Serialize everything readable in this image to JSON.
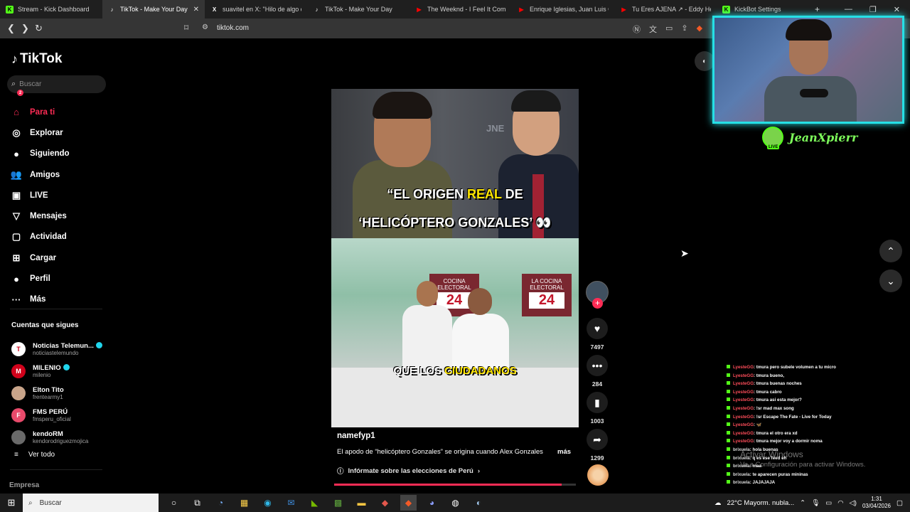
{
  "browser": {
    "tabs": [
      {
        "title": "Stream - Kick Dashboard",
        "color": "#53fc18",
        "glyph": "K",
        "active": false
      },
      {
        "title": "TikTok - Make Your Day",
        "color": "#ffffff",
        "glyph": "♪",
        "active": true
      },
      {
        "title": "suavitel en X: \"Hilo de algo que",
        "color": "#ffffff",
        "glyph": "X",
        "active": false
      },
      {
        "title": "TikTok - Make Your Day",
        "color": "#ffffff",
        "glyph": "♪",
        "active": false
      },
      {
        "title": "The Weeknd - I Feel It Coming",
        "color": "#ff0000",
        "glyph": "▶",
        "active": false
      },
      {
        "title": "Enrique Iglesias, Juan Luis Gue",
        "color": "#ff0000",
        "glyph": "▶",
        "active": false
      },
      {
        "title": "Tu Eres AJENA ↗ - Eddy Herr",
        "color": "#ff0000",
        "glyph": "▶",
        "active": false
      },
      {
        "title": "KickBot Settings",
        "color": "#53fc18",
        "glyph": "K",
        "active": false
      }
    ],
    "url": "tiktok.com"
  },
  "sidebar": {
    "logo": "TikTok",
    "search_placeholder": "Buscar",
    "menu": [
      {
        "label": "Para ti",
        "icon": "home-icon",
        "glyph": "⌂",
        "active": true
      },
      {
        "label": "Explorar",
        "icon": "compass-icon",
        "glyph": "◎",
        "active": false
      },
      {
        "label": "Siguiendo",
        "icon": "following-avatar-icon",
        "glyph": "●",
        "active": false
      },
      {
        "label": "Amigos",
        "icon": "friends-icon",
        "glyph": "👥",
        "active": false
      },
      {
        "label": "LIVE",
        "icon": "live-icon",
        "glyph": "▣",
        "active": false
      },
      {
        "label": "Mensajes",
        "icon": "messages-icon",
        "glyph": "▽",
        "active": false
      },
      {
        "label": "Actividad",
        "icon": "activity-icon",
        "glyph": "▢",
        "active": false,
        "badge": "2"
      },
      {
        "label": "Cargar",
        "icon": "upload-icon",
        "glyph": "⊞",
        "active": false
      },
      {
        "label": "Perfil",
        "icon": "profile-icon",
        "glyph": "●",
        "active": false
      },
      {
        "label": "Más",
        "icon": "more-icon",
        "glyph": "···",
        "active": false
      }
    ],
    "following_title": "Cuentas que sigues",
    "following": [
      {
        "name": "Noticias Telemun...",
        "handle": "noticiastelemundo",
        "verified": true,
        "av_color": "#ffffff",
        "av_text": "T"
      },
      {
        "name": "MILENIO",
        "handle": "milenio",
        "verified": true,
        "av_color": "#d0021b",
        "av_text": "M"
      },
      {
        "name": "Elton Tito",
        "handle": "frentearmy1",
        "verified": false,
        "av_color": "#c9a58a",
        "av_text": ""
      },
      {
        "name": "FMS PERÚ",
        "handle": "fmsperu_oficial",
        "verified": false,
        "av_color": "#e84a6b",
        "av_text": "F"
      },
      {
        "name": "kendoRM",
        "handle": "kendorodriguezmojica",
        "verified": false,
        "av_color": "#6a6a6a",
        "av_text": ""
      }
    ],
    "see_all": "Ver todo",
    "company": "Empresa"
  },
  "video": {
    "caption_line1_a": "“EL ORIGEN ",
    "caption_line1_b": "REAL",
    "caption_line1_c": " DE",
    "caption_line2": "‘HELICÓPTERO GONZALES’ 👀",
    "caption_bottom_a": "QUE LOS ",
    "caption_bottom_b": "CIUDADANOS",
    "bg_text_jne": "JNE",
    "set_label_1": "COCINA ELECTORAL",
    "set_label_2": "LA COCINA ELECTORAL",
    "set_number": "24",
    "username": "namefyp1",
    "description": "El apodo de “helicóptero Gonzales” se origina cuando Alex Gonzales",
    "more": "más",
    "info_link": "Infórmate sobre las elecciones de Perú",
    "progress": 0.94
  },
  "actions": {
    "likes": "7497",
    "comments": "284",
    "saves": "1003",
    "shares": "1299"
  },
  "stream_overlay": {
    "streamer_name": "JeanXpierr",
    "live_badge": "LIVE",
    "chat": [
      {
        "user": "LyesteGG",
        "msg": ": tmura pero subele volumen a tu micro"
      },
      {
        "user": "LyesteGG",
        "msg": ": tmura bueno,"
      },
      {
        "user": "LyesteGG",
        "msg": ": tmura buenas noches"
      },
      {
        "user": "LyesteGG",
        "msg": ": tmura cabro"
      },
      {
        "user": "LyesteGG",
        "msg": ": tmura asi esta mejor?"
      },
      {
        "user": "LyesteGG",
        "msg": ": !sr mad max song"
      },
      {
        "user": "LyesteGG",
        "msg": ": !sr Escape The Fate - Live for Today"
      },
      {
        "user": "LyesteGG",
        "msg": ": 🦋"
      },
      {
        "user": "LyesteGG",
        "msg": ": tmura el otro era xd"
      },
      {
        "user": "LyesteGG",
        "msg": ": tmura mejor voy a dormir noma"
      },
      {
        "user": "brixuela",
        "msg": ": hola buenas"
      },
      {
        "user": "brixuela",
        "msg": ": q es ese feed eh"
      },
      {
        "user": "brixuela",
        "msg": ": maa"
      },
      {
        "user": "brixuela",
        "msg": ": te aparecen puras mininas"
      },
      {
        "user": "brixuela",
        "msg": ": JAJAJAJA"
      }
    ]
  },
  "windows_watermark": {
    "line1": "Activar Windows",
    "line2": "Ve a Configuración para activar Windows."
  },
  "taskbar": {
    "search": "Buscar",
    "weather": "22°C  Mayorm. nubla...",
    "time": "1:31",
    "date": "03/04/2026"
  }
}
